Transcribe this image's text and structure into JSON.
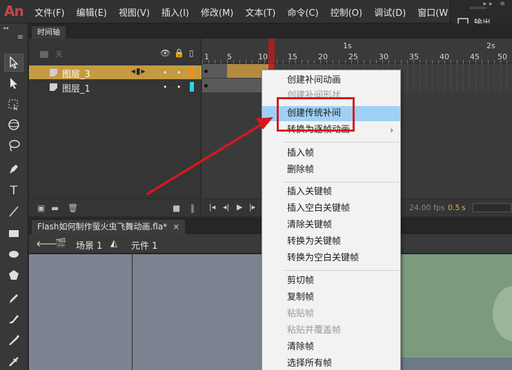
{
  "app": {
    "logo": "An",
    "menu": [
      "文件(F)",
      "编辑(E)",
      "视图(V)",
      "插入(I)",
      "修改(M)",
      "文本(T)",
      "命令(C)",
      "控制(O)",
      "调试(D)",
      "窗口(W"
    ],
    "output_label": "输出"
  },
  "timeline": {
    "tab": "时间轴",
    "header_label": "关",
    "second_markers": [
      "1s",
      "2s"
    ],
    "frame_numbers": [
      "1",
      "5",
      "10",
      "15",
      "20",
      "25",
      "30",
      "35",
      "40",
      "45",
      "50"
    ],
    "layers": [
      {
        "name": "图层_3",
        "color": "#ff8a1c",
        "active": true
      },
      {
        "name": "图层_1",
        "color": "#2ad6e6",
        "active": false
      }
    ],
    "fps": "24.00 fps",
    "seconds": "0.5",
    "seconds_unit": "s"
  },
  "document": {
    "tab": "Flash如何制作萤火虫飞舞动画.fla*",
    "close_glyph": "×",
    "scene": "场景 1",
    "symbol": "元件 1"
  },
  "context_menu": {
    "items": [
      {
        "label": "创建补间动画",
        "disabled": false
      },
      {
        "label": "创建补间形状",
        "disabled": true
      },
      {
        "label": "创建传统补间",
        "disabled": false,
        "highlighted": true
      },
      {
        "label": "转换为逐帧动画",
        "disabled": false,
        "submenu": true
      },
      {
        "label": "插入帧",
        "disabled": false
      },
      {
        "label": "删除帧",
        "disabled": false
      },
      {
        "label": "插入关键帧",
        "disabled": false
      },
      {
        "label": "插入空白关键帧",
        "disabled": false
      },
      {
        "label": "清除关键帧",
        "disabled": false
      },
      {
        "label": "转换为关键帧",
        "disabled": false
      },
      {
        "label": "转换为空白关键帧",
        "disabled": false
      },
      {
        "label": "剪切帧",
        "disabled": false
      },
      {
        "label": "复制帧",
        "disabled": false
      },
      {
        "label": "粘贴帧",
        "disabled": true
      },
      {
        "label": "粘贴并覆盖帧",
        "disabled": true
      },
      {
        "label": "清除帧",
        "disabled": false
      },
      {
        "label": "选择所有帧",
        "disabled": false
      }
    ],
    "submenu_glyph": "›"
  },
  "colors": {
    "highlight": "#9fd0f5",
    "annotation": "#d6181e",
    "active_layer": "#c69a40",
    "playhead": "#b01e1e"
  },
  "tools": [
    "selection-tool-icon",
    "subselection-tool-icon",
    "free-transform-tool-icon",
    "3d-rotation-tool-icon",
    "lasso-tool-icon",
    "pen-tool-icon",
    "text-tool-icon",
    "line-tool-icon",
    "rectangle-tool-icon",
    "oval-tool-icon",
    "polystar-tool-icon",
    "pencil-tool-icon",
    "paint-brush-tool-icon",
    "brush-tool-icon",
    "bone-tool-icon"
  ],
  "text_tool_glyph": "T"
}
